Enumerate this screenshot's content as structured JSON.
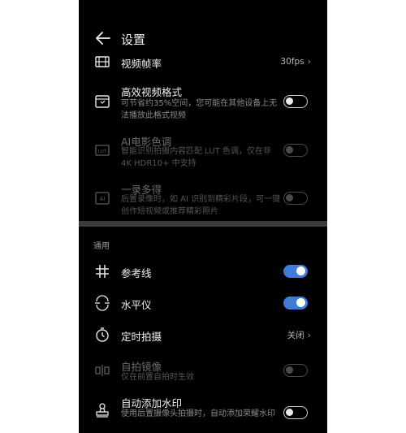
{
  "header": {
    "title": "设置"
  },
  "video_frame_rate": {
    "title": "视频帧率",
    "value": "30fps",
    "icon": "film-icon"
  },
  "efficient_format": {
    "title": "高效视频格式",
    "desc": "可节省约35%空间，您可能在其他设备上无法播放此格式视频",
    "enabled": false,
    "icon": "hevc-icon"
  },
  "ai_color": {
    "title": "AI电影色调",
    "desc": "智能识别拍摄内容匹配 LUT 色调，仅在非 4K HDR10+ 中支持",
    "enabled": false,
    "disabled": true,
    "icon": "lut-icon"
  },
  "one_take": {
    "title": "一录多得",
    "desc": "后置录像时，如 AI 识别到精彩片段，可一键创作短视频或推荐精彩照片",
    "enabled": false,
    "disabled": true,
    "icon": "ai-icon"
  },
  "section": {
    "general": "通用"
  },
  "grid": {
    "title": "参考线",
    "enabled": true,
    "icon": "grid-icon"
  },
  "level": {
    "title": "水平仪",
    "enabled": true,
    "icon": "level-icon"
  },
  "timer": {
    "title": "定时拍摄",
    "value": "关闭",
    "icon": "timer-icon"
  },
  "mirror": {
    "title": "自拍镜像",
    "desc": "仅在前置自拍时生效",
    "enabled": false,
    "disabled": true,
    "icon": "mirror-icon"
  },
  "watermark": {
    "title": "自动添加水印",
    "desc": "使用后置摄像头拍摄时，自动添加荣耀水印",
    "enabled": false,
    "icon": "stamp-icon"
  },
  "colors": {
    "accent": "#3f7cd8",
    "background": "#000000"
  }
}
